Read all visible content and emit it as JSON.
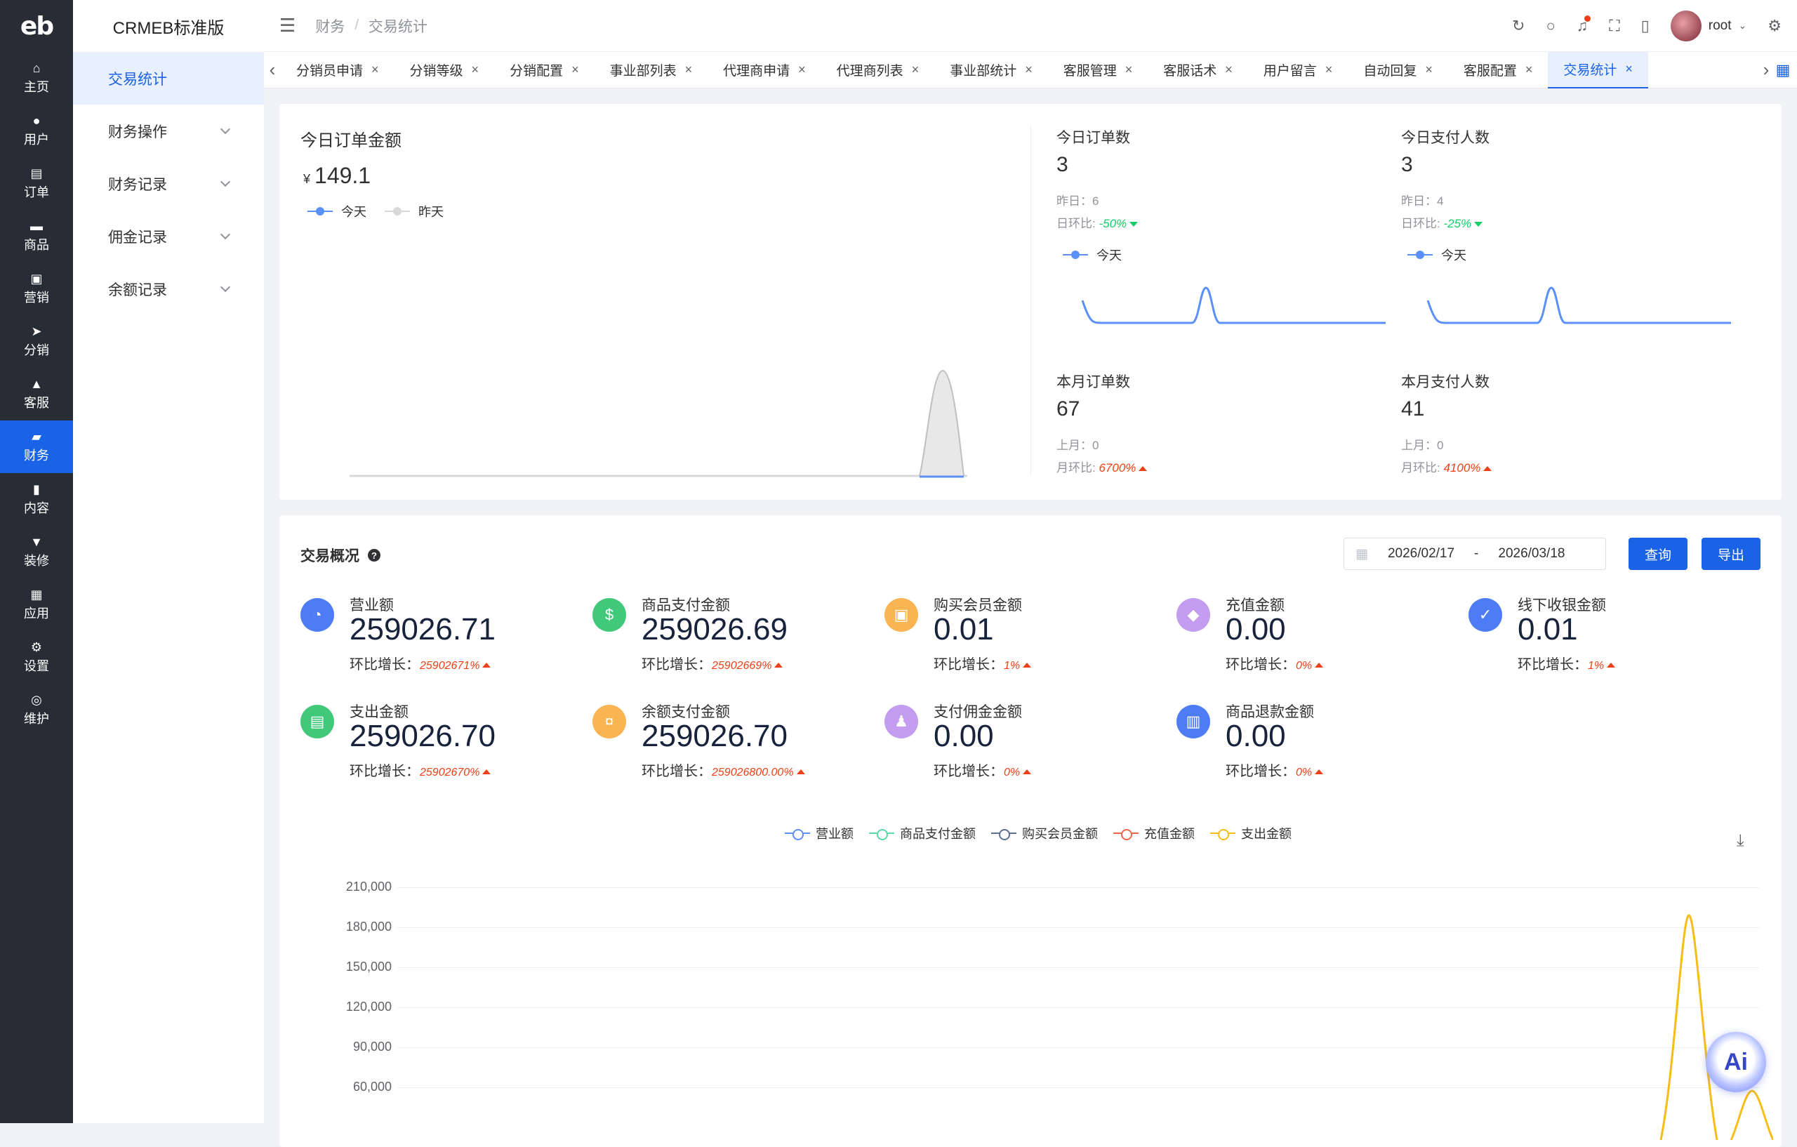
{
  "rail": {
    "logo": "eb",
    "items": [
      {
        "label": "主页",
        "icon": "home-icon",
        "glyph": "⌂"
      },
      {
        "label": "用户",
        "icon": "user-icon",
        "glyph": "●"
      },
      {
        "label": "订单",
        "icon": "order-icon",
        "glyph": "▤"
      },
      {
        "label": "商品",
        "icon": "product-icon",
        "glyph": "▬"
      },
      {
        "label": "营销",
        "icon": "marketing-icon",
        "glyph": "▣"
      },
      {
        "label": "分销",
        "icon": "send-icon",
        "glyph": "➤"
      },
      {
        "label": "客服",
        "icon": "bell-icon",
        "glyph": "▲"
      },
      {
        "label": "财务",
        "icon": "wallet-icon",
        "glyph": "▰"
      },
      {
        "label": "内容",
        "icon": "book-icon",
        "glyph": "▮"
      },
      {
        "label": "装修",
        "icon": "brush-icon",
        "glyph": "▼"
      },
      {
        "label": "应用",
        "icon": "apps-icon",
        "glyph": "▦"
      },
      {
        "label": "设置",
        "icon": "gear-icon",
        "glyph": "⚙"
      },
      {
        "label": "维护",
        "icon": "chip-icon",
        "glyph": "◎"
      }
    ]
  },
  "menu": {
    "brand": "CRMEB标准版",
    "items": [
      {
        "label": "交易统计"
      },
      {
        "label": "财务操作"
      },
      {
        "label": "财务记录"
      },
      {
        "label": "佣金记录"
      },
      {
        "label": "余额记录"
      }
    ]
  },
  "header": {
    "crumb1": "财务",
    "crumb_sep": "/",
    "crumb2": "交易统计",
    "user": "root"
  },
  "tabs": [
    {
      "label": "分销员申请"
    },
    {
      "label": "分销等级"
    },
    {
      "label": "分销配置"
    },
    {
      "label": "事业部列表"
    },
    {
      "label": "代理商申请"
    },
    {
      "label": "代理商列表"
    },
    {
      "label": "事业部统计"
    },
    {
      "label": "客服管理"
    },
    {
      "label": "客服话术"
    },
    {
      "label": "用户留言"
    },
    {
      "label": "自动回复"
    },
    {
      "label": "客服配置"
    },
    {
      "label": "交易统计"
    }
  ],
  "today": {
    "title": "今日订单金额",
    "currency": "¥",
    "amount": "149.1",
    "legend_today": "今天",
    "legend_yesterday": "昨天",
    "colors": {
      "today": "#5b8ff9",
      "yesterday": "#d9d9d9"
    },
    "orders": {
      "label": "今日订单数",
      "value": "3",
      "prev_label": "昨日：",
      "prev": "6",
      "cmp_label": "日环比:",
      "cmp": "-50%",
      "legend": "今天"
    },
    "payers": {
      "label": "今日支付人数",
      "value": "3",
      "prev_label": "昨日：",
      "prev": "4",
      "cmp_label": "日环比:",
      "cmp": "-25%",
      "legend": "今天"
    },
    "month_orders": {
      "label": "本月订单数",
      "value": "67",
      "prev_label": "上月：",
      "prev": "0",
      "cmp_label": "月环比:",
      "cmp": "6700%"
    },
    "month_payers": {
      "label": "本月支付人数",
      "value": "41",
      "prev_label": "上月：",
      "prev": "0",
      "cmp_label": "月环比:",
      "cmp": "4100%"
    }
  },
  "overview": {
    "title": "交易概况",
    "date_start": "2026/02/17",
    "date_sep": "-",
    "date_end": "2026/03/18",
    "query_btn": "查询",
    "export_btn": "导出",
    "change_label": "环比增长：",
    "metrics": [
      {
        "label": "营业额",
        "value": "259026.71",
        "change": "25902671%",
        "color": "#4e7cf6",
        "icon": "chart-pie-icon",
        "glyph": "◔"
      },
      {
        "label": "商品支付金额",
        "value": "259026.69",
        "change": "25902669%",
        "color": "#41c97a",
        "icon": "money-icon",
        "glyph": "$"
      },
      {
        "label": "购买会员金额",
        "value": "0.01",
        "change": "1%",
        "color": "#f8b551",
        "icon": "lock-icon",
        "glyph": "▣"
      },
      {
        "label": "充值金额",
        "value": "0.00",
        "change": "0%",
        "color": "#c49cf0",
        "icon": "diamond-icon",
        "glyph": "◆"
      },
      {
        "label": "线下收银金额",
        "value": "0.01",
        "change": "1%",
        "color": "#4e7cf6",
        "icon": "check-icon",
        "glyph": "✓"
      },
      {
        "label": "支出金额",
        "value": "259026.70",
        "change": "25902670%",
        "color": "#41c97a",
        "icon": "wallet-icon",
        "glyph": "▤"
      },
      {
        "label": "余额支付金额",
        "value": "259026.70",
        "change": "259026800.00%",
        "color": "#f8b551",
        "icon": "coin-icon",
        "glyph": "¤"
      },
      {
        "label": "支付佣金金额",
        "value": "0.00",
        "change": "0%",
        "color": "#c49cf0",
        "icon": "user-icon",
        "glyph": "♟"
      },
      {
        "label": "商品退款金额",
        "value": "0.00",
        "change": "0%",
        "color": "#4e7cf6",
        "icon": "refund-icon",
        "glyph": "▥"
      }
    ]
  },
  "chart_data": {
    "type": "line",
    "series": [
      {
        "name": "营业额",
        "color": "#5b8ff9"
      },
      {
        "name": "商品支付金额",
        "color": "#5ad8a6"
      },
      {
        "name": "购买会员金额",
        "color": "#5d7092"
      },
      {
        "name": "充值金额",
        "color": "#e8684a"
      },
      {
        "name": "支出金额",
        "color": "#f6bd16"
      }
    ],
    "y_ticks": [
      "210,000",
      "180,000",
      "150,000",
      "120,000",
      "90,000",
      "60,000"
    ],
    "ylim_visible": [
      60000,
      210000
    ]
  }
}
